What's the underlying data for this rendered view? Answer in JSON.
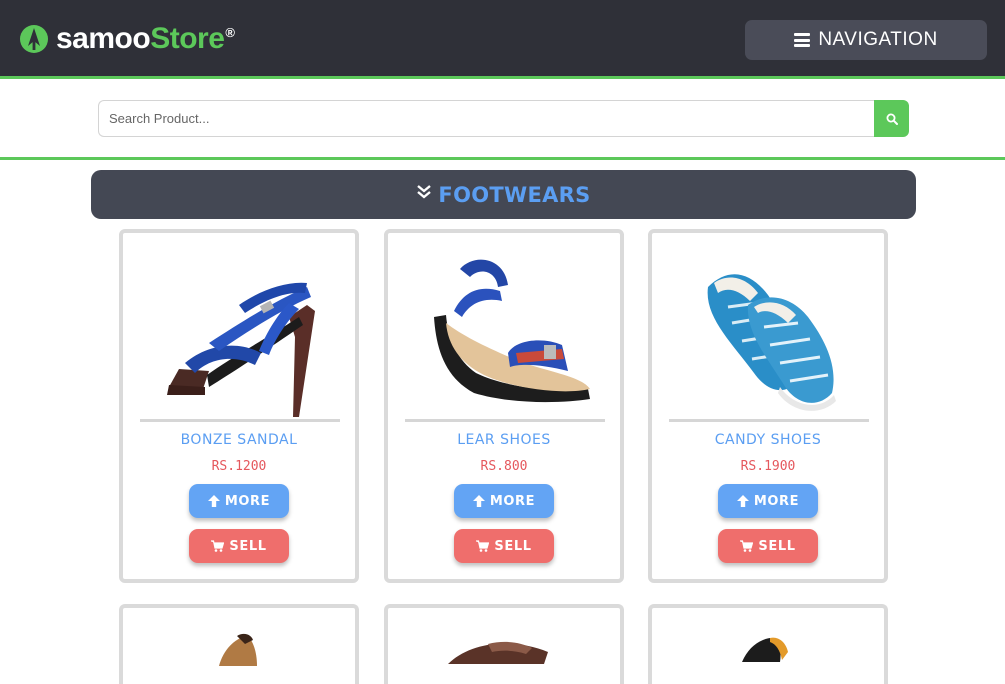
{
  "header": {
    "brand_part1": "samoo",
    "brand_part2": "Store",
    "brand_reg": "®",
    "nav_label": "NAVIGATION"
  },
  "search": {
    "placeholder": "Search Product...",
    "value": ""
  },
  "category": {
    "title": "FOOTWEARS"
  },
  "products": [
    {
      "name": "BONZE SANDAL",
      "price": "RS.1200",
      "more_label": "MORE",
      "sell_label": "SELL"
    },
    {
      "name": "LEAR SHOES",
      "price": "RS.800",
      "more_label": "MORE",
      "sell_label": "SELL"
    },
    {
      "name": "CANDY SHOES",
      "price": "RS.1900",
      "more_label": "MORE",
      "sell_label": "SELL"
    }
  ],
  "colors": {
    "header_bg": "#2f3038",
    "accent_green": "#5cc85a",
    "category_bg": "#444854",
    "link_blue": "#5b9ef2",
    "price_red": "#e5585d",
    "more_blue": "#63a4f4",
    "sell_red": "#ef6e6c"
  },
  "icons": {
    "brand": "samoo-logo-icon",
    "nav": "hamburger-icon",
    "search": "search-icon",
    "category": "double-chevron-down-icon",
    "more": "arrow-up-icon",
    "sell": "cart-icon"
  }
}
